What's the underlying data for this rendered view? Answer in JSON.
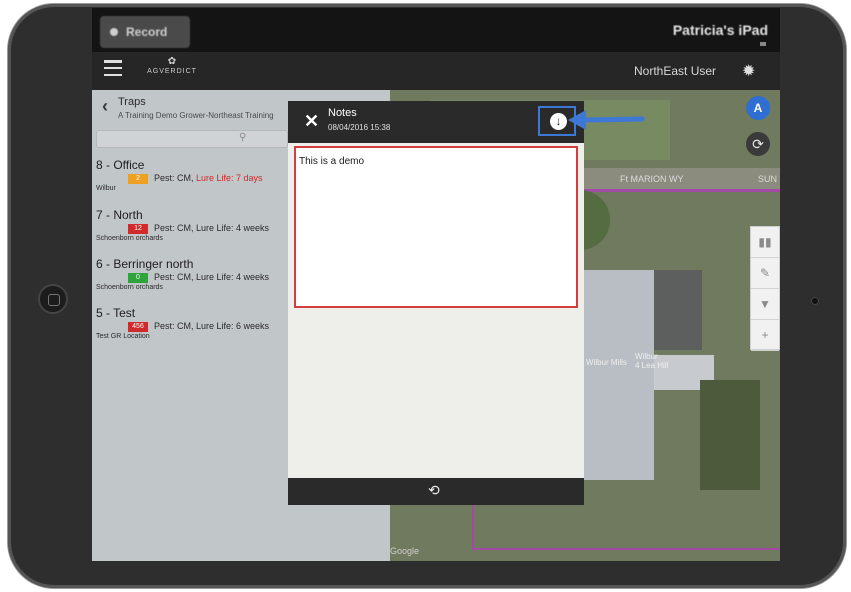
{
  "statusbar": {
    "record_label": "Record",
    "device_name": "Patricia's iPad"
  },
  "appbar": {
    "logo_text": "AGVERDICT",
    "user": "NorthEast User"
  },
  "sidebar": {
    "title": "Traps",
    "subtitle": "A Training Demo Grower-Northeast Training",
    "traps": [
      {
        "name": "8 - Office",
        "badge": "2",
        "badge_color": "#f0a020",
        "pest": "Pest: CM, ",
        "lure": "Lure Life: 7 days",
        "lure_alert": true,
        "grower": "Wilbur"
      },
      {
        "name": "7 - North",
        "badge": "12",
        "badge_color": "#d12a2a",
        "pest": "Pest: CM, ",
        "lure": "Lure Life: 4 weeks",
        "lure_alert": false,
        "grower": "Schoenborn orchards"
      },
      {
        "name": "6 - Berringer north",
        "badge": "0",
        "badge_color": "#2ea43a",
        "pest": "Pest: CM, ",
        "lure": "Lure Life: 4 weeks",
        "lure_alert": false,
        "grower": "Schoenborn orchards"
      },
      {
        "name": "5 - Test",
        "badge": "456",
        "badge_color": "#d12a2a",
        "pest": "Pest: CM, ",
        "lure": "Lure Life: 6 weeks",
        "lure_alert": false,
        "grower": "Test GR Location"
      }
    ]
  },
  "map": {
    "road_label": "Ft MARION WY",
    "road_label_right": "SUN",
    "label_a": "Wilbur Mills",
    "label_b": "Wilbur\n4 Lea Hill",
    "watermark": "Google",
    "nav_label": "A"
  },
  "modal": {
    "title": "Notes",
    "date": "08/04/2016 15:38",
    "note": "This is a demo"
  }
}
